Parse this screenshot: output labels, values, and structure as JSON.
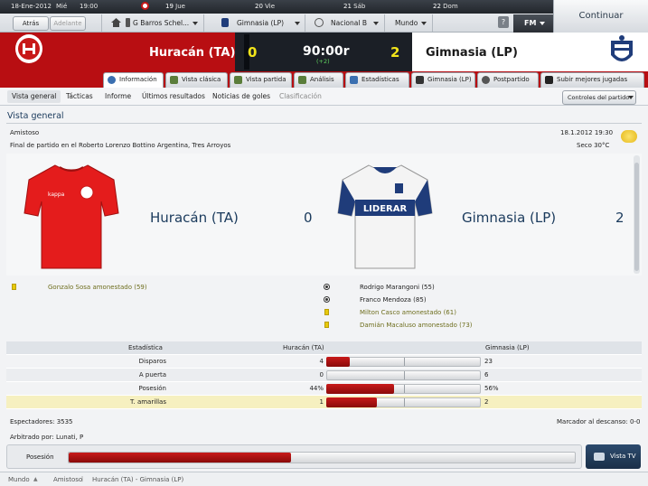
{
  "topbar": {
    "date": "18-Ene-2012",
    "weekday": "Mié",
    "time": "19:00",
    "days": [
      {
        "num": "19",
        "name": "Jue"
      },
      {
        "num": "20",
        "name": "Vie"
      },
      {
        "num": "21",
        "name": "Sáb"
      },
      {
        "num": "22",
        "name": "Dom"
      }
    ],
    "back": "Atrás",
    "forward": "Adelante",
    "manager": "G Barros Schel...",
    "team": "Gimnasia (LP)",
    "competition": "Nacional B",
    "world": "Mundo",
    "help": "?",
    "fm": "FM",
    "continue": "Continuar"
  },
  "match": {
    "home": "Huracán (TA)",
    "away": "Gimnasia (LP)",
    "home_goals": "0",
    "away_goals": "2",
    "clock": "90:00r",
    "added": "(+2)"
  },
  "tabs": [
    "Información",
    "Vista clásica",
    "Vista partida",
    "Análisis",
    "Estadísticas",
    "Gimnasia (LP)",
    "Postpartido",
    "Subir mejores jugadas"
  ],
  "subnav": {
    "items": [
      "Vista general",
      "Tácticas",
      "Informe",
      "Últimos resultados",
      "Noticias de goles",
      "Clasificación"
    ],
    "controls": "Controles del partido"
  },
  "overview": {
    "section_title": "Vista general",
    "competition": "Amistoso",
    "datetime": "18.1.2012 19:30",
    "venue": "Final de partido en el Roberto Lorenzo Bottino Argentina, Tres Arroyos",
    "weather": "Seco 30°C",
    "home_name": "Huracán (TA)",
    "home_score": "0",
    "away_name": "Gimnasia (LP)",
    "away_score": "2",
    "kit_sponsor": "LIDERAR"
  },
  "events": {
    "home": [
      {
        "type": "card",
        "text": "Gonzalo Sosa amonestado (59)"
      }
    ],
    "away": [
      {
        "type": "goal",
        "text": "Rodrigo Marangoni (55)"
      },
      {
        "type": "goal",
        "text": "Franco Mendoza (85)"
      },
      {
        "type": "card",
        "text": "Milton Casco amonestado (61)"
      },
      {
        "type": "card",
        "text": "Damián Macaluso amonestado (73)"
      }
    ]
  },
  "stats": {
    "header": {
      "label": "Estadística",
      "home": "Huracán (TA)",
      "away": "Gimnasia (LP)"
    },
    "rows": [
      {
        "label": "Disparos",
        "home": "4",
        "away": "23",
        "home_frac": 0.15
      },
      {
        "label": "A puerta",
        "home": "0",
        "away": "6",
        "home_frac": 0.0
      },
      {
        "label": "Posesión",
        "home": "44%",
        "away": "56%",
        "home_frac": 0.44
      },
      {
        "label": "T. amarillas",
        "home": "1",
        "away": "2",
        "home_frac": 0.33
      }
    ]
  },
  "footer_info": {
    "attendance": "Espectadores: 3535",
    "halftime": "Marcador al descanso: 0-0",
    "referee": "Arbitrado por: Lunati, P"
  },
  "possession_bar": {
    "label": "Posesión",
    "home_frac": 0.44,
    "tv": "Vista TV"
  },
  "breadcrumb": [
    "Mundo",
    "Amistoso",
    "Huracán (TA) - Gimnasia (LP)"
  ],
  "colors": {
    "home": "#b80e12",
    "bar": "#a10e0e",
    "highlight": "#f6f0c0"
  }
}
